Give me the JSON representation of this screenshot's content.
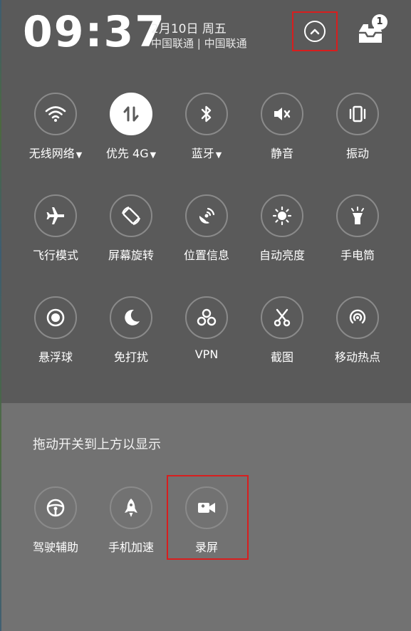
{
  "status": {
    "time": "09:37",
    "date": "2月10日 周五",
    "carrier": "中国联通 | 中国联通",
    "notification_count": "1"
  },
  "tiles_row1": [
    {
      "label": "无线网络",
      "icon": "wifi-icon",
      "dropdown": true
    },
    {
      "label": "优先 4G",
      "icon": "data-transfer-icon",
      "dropdown": true,
      "active": true
    },
    {
      "label": "蓝牙",
      "icon": "bluetooth-icon",
      "dropdown": true
    },
    {
      "label": "静音",
      "icon": "mute-icon"
    },
    {
      "label": "振动",
      "icon": "vibrate-icon"
    }
  ],
  "tiles_row2": [
    {
      "label": "飞行模式",
      "icon": "airplane-icon"
    },
    {
      "label": "屏幕旋转",
      "icon": "rotate-screen-icon"
    },
    {
      "label": "位置信息",
      "icon": "location-icon"
    },
    {
      "label": "自动亮度",
      "icon": "brightness-icon"
    },
    {
      "label": "手电筒",
      "icon": "flashlight-icon"
    }
  ],
  "tiles_row3": [
    {
      "label": "悬浮球",
      "icon": "float-ball-icon"
    },
    {
      "label": "免打扰",
      "icon": "moon-icon"
    },
    {
      "label": "VPN",
      "icon": "vpn-icon"
    },
    {
      "label": "截图",
      "icon": "scissors-icon"
    },
    {
      "label": "移动热点",
      "icon": "hotspot-icon"
    }
  ],
  "hint": "拖动开关到上方以显示",
  "extra_tiles": [
    {
      "label": "驾驶辅助",
      "icon": "steering-wheel-icon"
    },
    {
      "label": "手机加速",
      "icon": "rocket-icon"
    },
    {
      "label": "录屏",
      "icon": "video-camera-icon"
    }
  ],
  "colors": {
    "top_panel": "#5a5a5a",
    "bottom_panel": "#727272",
    "highlight": "#d81e1e"
  }
}
